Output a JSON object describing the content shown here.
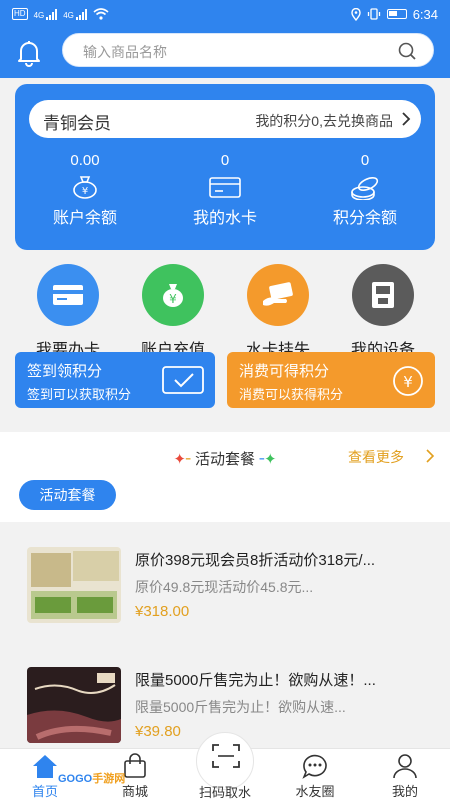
{
  "status_bar": {
    "network_tag": "HD",
    "signal_1": "4G",
    "signal_2": "4G",
    "time": "6:34"
  },
  "header": {
    "search_placeholder": "输入商品名称"
  },
  "member": {
    "level": "青铜会员",
    "points_text": "我的积分0,去兑换商品"
  },
  "stats": [
    {
      "value": "0.00",
      "label": "账户余额",
      "icon": "money-bag-icon"
    },
    {
      "value": "0",
      "label": "我的水卡",
      "icon": "card-icon"
    },
    {
      "value": "0",
      "label": "积分余额",
      "icon": "coins-icon"
    }
  ],
  "quick_actions": [
    {
      "label": "我要办卡",
      "icon": "card-icon",
      "color": "#3b8ff0"
    },
    {
      "label": "账户充值",
      "icon": "money-bag-icon",
      "color": "#3fc25e"
    },
    {
      "label": "水卡挂失",
      "icon": "hand-card-icon",
      "color": "#f49a2c"
    },
    {
      "label": "我的设备",
      "icon": "device-icon",
      "color": "#5b5b5b"
    }
  ],
  "promos": [
    {
      "title": "签到领积分",
      "subtitle": "签到可以获取积分",
      "color": "#2f84ee"
    },
    {
      "title": "消费可得积分",
      "subtitle": "消费可以获得积分",
      "color": "#f49a2c"
    }
  ],
  "section": {
    "title": "活动套餐",
    "more": "查看更多",
    "chip": "活动套餐"
  },
  "products": [
    {
      "name": "原价398元现会员8折活动价318元/...",
      "desc": "原价49.8元现活动价45.8元...",
      "price": "¥318.00"
    },
    {
      "name": "限量5000斤售完为止！欲购从速！...",
      "desc": "限量5000斤售完为止！欲购从速...",
      "price": "¥39.80"
    }
  ],
  "tabs": [
    {
      "label": "首页",
      "icon": "home-icon"
    },
    {
      "label": "商城",
      "icon": "shopping-bag-icon"
    },
    {
      "label": "扫码取水",
      "icon": "scan-icon"
    },
    {
      "label": "水友圈",
      "icon": "chat-icon"
    },
    {
      "label": "我的",
      "icon": "person-icon"
    }
  ],
  "watermark": {
    "part1": "GOGO",
    "part2": "手游网"
  },
  "colors": {
    "primary": "#2f84ee",
    "accent": "#f49a2c",
    "price": "#e2a020"
  }
}
